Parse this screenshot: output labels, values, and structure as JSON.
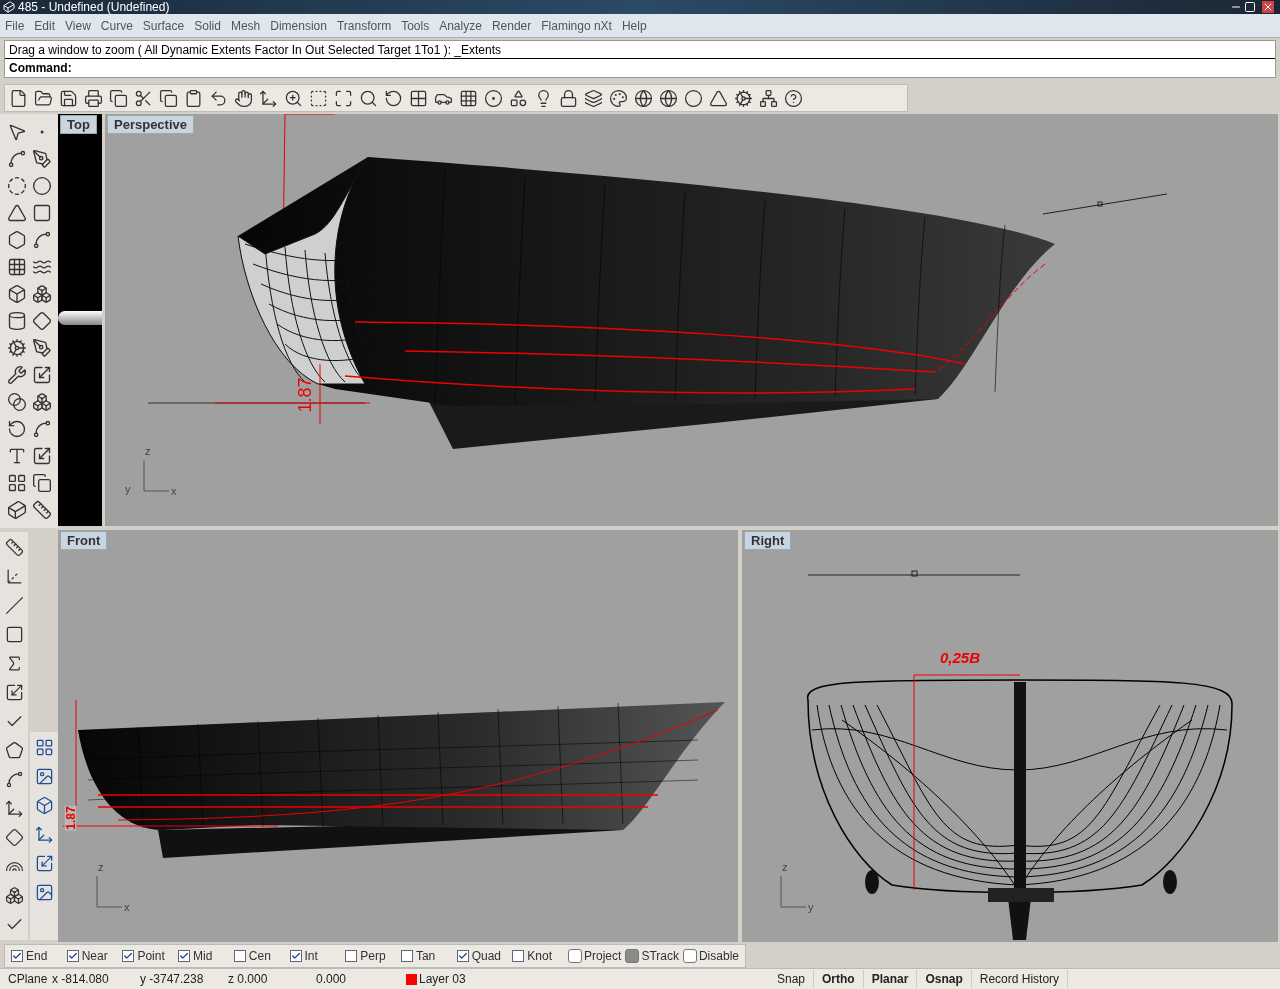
{
  "window": {
    "title": "485 - Undefined (Undefined)"
  },
  "menu": [
    "File",
    "Edit",
    "View",
    "Curve",
    "Surface",
    "Solid",
    "Mesh",
    "Dimension",
    "Transform",
    "Tools",
    "Analyze",
    "Render",
    "Flamingo nXt",
    "Help"
  ],
  "command": {
    "history": "Drag a window to zoom ( All  Dynamic  Extents  Factor  In  Out  Selected  Target  1To1 ): _Extents",
    "prompt": "Command:"
  },
  "viewports": [
    {
      "title": "Top",
      "kind": "top"
    },
    {
      "title": "Perspective",
      "kind": "perspective",
      "dimension": "1.87",
      "axes": {
        "vertical": "z",
        "left": "y",
        "right": "x"
      }
    },
    {
      "title": "Front",
      "kind": "front",
      "dimension": "1.87",
      "axes": {
        "vertical": "z",
        "right": "x"
      }
    },
    {
      "title": "Right",
      "kind": "right",
      "dimension": "0,25B",
      "axes": {
        "vertical": "z",
        "right": "y"
      }
    }
  ],
  "osnaps": [
    {
      "label": "End",
      "checked": true
    },
    {
      "label": "Near",
      "checked": true
    },
    {
      "label": "Point",
      "checked": true
    },
    {
      "label": "Mid",
      "checked": true
    },
    {
      "label": "Cen",
      "checked": false
    },
    {
      "label": "Int",
      "checked": true
    },
    {
      "label": "Perp",
      "checked": false
    },
    {
      "label": "Tan",
      "checked": false
    },
    {
      "label": "Quad",
      "checked": true
    },
    {
      "label": "Knot",
      "checked": false
    }
  ],
  "toggles": [
    {
      "label": "Project",
      "on": false
    },
    {
      "label": "STrack",
      "on": true
    },
    {
      "label": "Disable",
      "on": false
    }
  ],
  "status": {
    "cplane": "CPlane",
    "x": "x -814.080",
    "y": "y -3747.238",
    "z": "z 0.000",
    "distance": "0.000",
    "layer": {
      "name": "Layer 03",
      "color": "#ff0000"
    },
    "panes": [
      {
        "label": "Snap",
        "on": false
      },
      {
        "label": "Ortho",
        "on": true
      },
      {
        "label": "Planar",
        "on": true
      },
      {
        "label": "Osnap",
        "on": true
      },
      {
        "label": "Record History",
        "on": false
      }
    ]
  }
}
